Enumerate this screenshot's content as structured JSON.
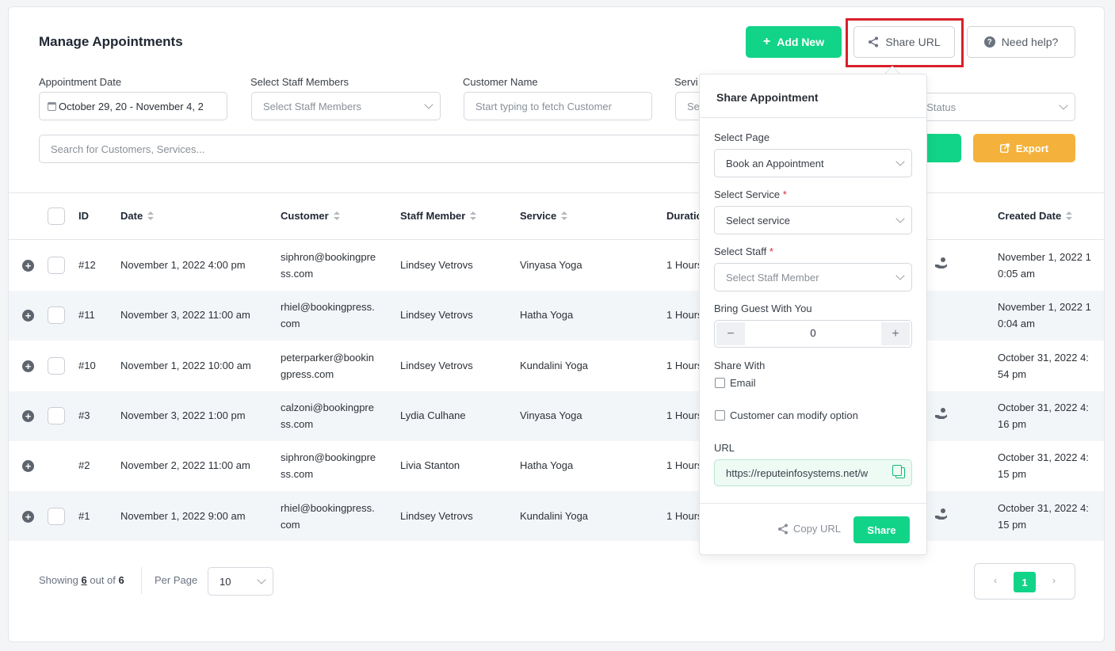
{
  "page": {
    "title": "Manage Appointments",
    "add_new_label": "Add New",
    "share_url_label": "Share URL",
    "help_label": "Need help?",
    "export_label": "Export"
  },
  "filters": {
    "date_label": "Appointment Date",
    "date_value": "October 29, 20  -  November 4, 2",
    "staff_label": "Select Staff Members",
    "staff_placeholder": "Select Staff Members",
    "customer_label": "Customer Name",
    "customer_placeholder": "Start typing to fetch Customer",
    "service_label": "Servi",
    "service_placeholder": "Se",
    "status_placeholder": "t Status",
    "search_placeholder": "Search for Customers, Services..."
  },
  "table": {
    "headers": [
      "ID",
      "Date",
      "Customer",
      "Staff Member",
      "Service",
      "Duratio",
      "Created Date"
    ],
    "rows": [
      {
        "id": "#12",
        "date": "November 1, 2022 4:00 pm",
        "customer1": "siphron@bookingpre",
        "customer2": "ss.com",
        "staff": "Lindsey Vetrovs",
        "service": "Vinyasa Yoga",
        "duration": "1 Hours",
        "created1": "November 1, 2022 1",
        "created2": "0:05 am"
      },
      {
        "id": "#11",
        "date": "November 3, 2022 11:00 am",
        "customer1": "rhiel@bookingpress.",
        "customer2": "com",
        "staff": "Lindsey Vetrovs",
        "service": "Hatha Yoga",
        "duration": "1 Hours",
        "created1": "November 1, 2022 1",
        "created2": "0:04 am"
      },
      {
        "id": "#10",
        "date": "November 1, 2022 10:00 am",
        "customer1": "peterparker@bookin",
        "customer2": "gpress.com",
        "staff": "Lindsey Vetrovs",
        "service": "Kundalini Yoga",
        "duration": "1 Hours",
        "created1": "October 31, 2022 4:",
        "created2": "54 pm"
      },
      {
        "id": "#3",
        "date": "November 3, 2022 1:00 pm",
        "customer1": "calzoni@bookingpre",
        "customer2": "ss.com",
        "staff": "Lydia Culhane",
        "service": "Vinyasa Yoga",
        "duration": "1 Hours",
        "created1": "October 31, 2022 4:",
        "created2": "16 pm"
      },
      {
        "id": "#2",
        "date": "November 2, 2022 11:00 am",
        "customer1": "siphron@bookingpre",
        "customer2": "ss.com",
        "staff": "Livia Stanton",
        "service": "Hatha Yoga",
        "duration": "1 Hours",
        "created1": "October 31, 2022 4:",
        "created2": "15 pm"
      },
      {
        "id": "#1",
        "date": "November 1, 2022 9:00 am",
        "customer1": "rhiel@bookingpress.",
        "customer2": "com",
        "staff": "Lindsey Vetrovs",
        "service": "Kundalini Yoga",
        "duration": "1 Hours",
        "created1": "October 31, 2022 4:",
        "created2": "15 pm"
      }
    ]
  },
  "footer": {
    "showing_prefix": "Showing",
    "showing_count": "6",
    "showing_mid": "out of",
    "showing_total": "6",
    "per_page_label": "Per Page",
    "per_page_value": "10",
    "prev": "‹",
    "current_page": "1",
    "next": "›"
  },
  "share_popup": {
    "title": "Share Appointment",
    "page_label": "Select Page",
    "page_value": "Book an Appointment",
    "service_label": "Select Service",
    "service_placeholder": "Select service",
    "staff_label": "Select Staff",
    "staff_placeholder": "Select Staff Member",
    "required_mark": "*",
    "guest_label": "Bring Guest With You",
    "guest_minus": "−",
    "guest_value": "0",
    "guest_plus": "+",
    "share_with_label": "Share With",
    "email_label": "Email",
    "modify_label": "Customer can modify option",
    "url_label": "URL",
    "url_value": "https://reputeinfosystems.net/w",
    "copy_url_label": "Copy URL",
    "share_button_label": "Share"
  },
  "colors": {
    "accent": "#12d488",
    "export": "#f4b23c",
    "highlight_box": "#d8202c"
  }
}
